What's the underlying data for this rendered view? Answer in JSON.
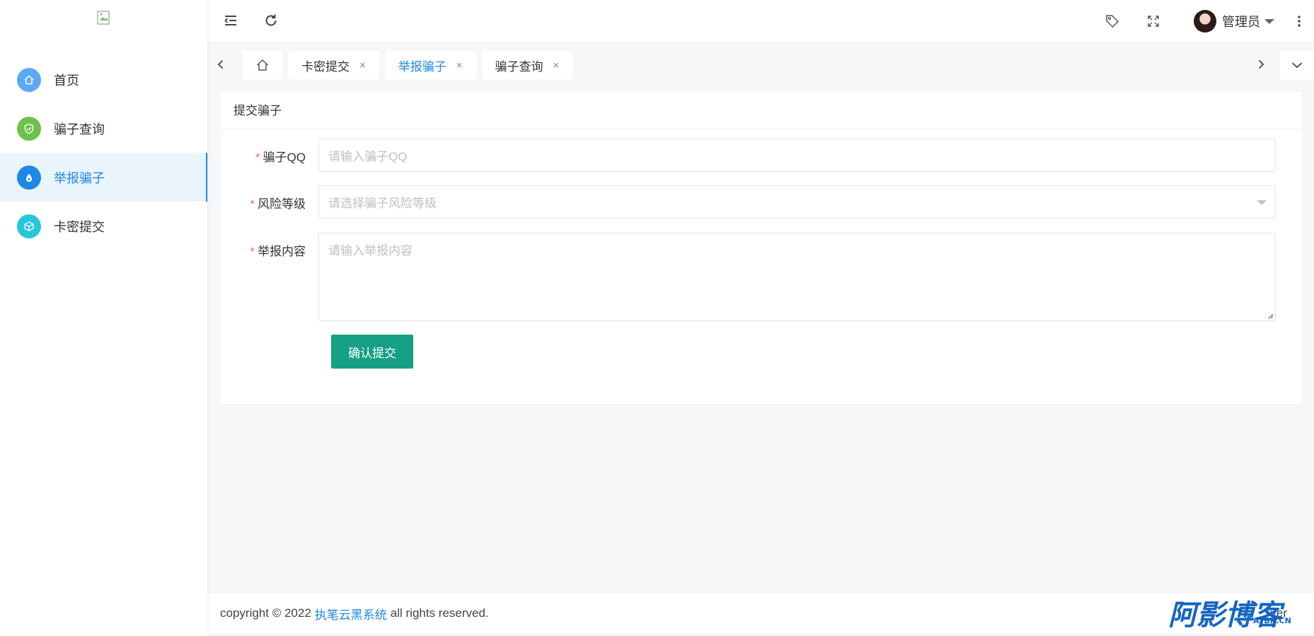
{
  "sidebar": {
    "logo_icon": "broken-image-icon",
    "items": [
      {
        "label": "首页",
        "icon": "home-icon",
        "color": "#5aa9f5",
        "active": false
      },
      {
        "label": "骗子查询",
        "icon": "shield-check-icon",
        "color": "#6cc24a",
        "active": false
      },
      {
        "label": "举报骗子",
        "icon": "alert-drop-icon",
        "color": "#1e88e5",
        "active": true
      },
      {
        "label": "卡密提交",
        "icon": "cube-icon",
        "color": "#26c6da",
        "active": false
      }
    ]
  },
  "header": {
    "collapse_icon": "menu-collapse-icon",
    "refresh_icon": "refresh-icon",
    "tag_icon": "tag-icon",
    "fullscreen_icon": "fullscreen-icon",
    "user_name": "管理员",
    "more_icon": "more-vertical-icon"
  },
  "tabs": {
    "items": [
      {
        "label": "卡密提交",
        "active": false
      },
      {
        "label": "举报骗子",
        "active": true
      },
      {
        "label": "骗子查询",
        "active": false
      }
    ],
    "close_glyph": "×"
  },
  "card": {
    "title": "提交骗子",
    "qq_label": "骗子QQ",
    "qq_placeholder": "请输入骗子QQ",
    "risk_label": "风险等级",
    "risk_placeholder": "请选择骗子风险等级",
    "content_label": "举报内容",
    "content_placeholder": "请输入举报内容",
    "required_mark": "*",
    "submit_label": "确认提交"
  },
  "footer": {
    "prefix": "copyright © 2022",
    "link": "执笔云黑系统",
    "suffix": "all rights reserved.",
    "version": "ver"
  },
  "watermark": {
    "text": "阿影博客",
    "domain": "AYBK.CN"
  },
  "colors": {
    "primary": "#1e88e5",
    "submit": "#16a085",
    "required": "#f56c6c"
  }
}
